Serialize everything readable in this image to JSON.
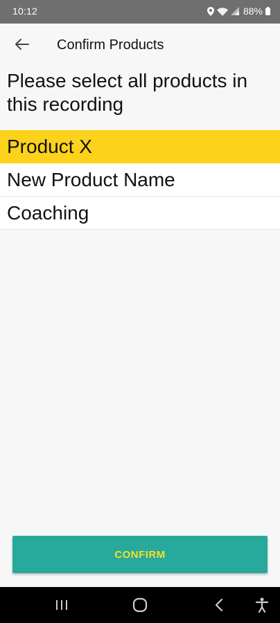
{
  "status_bar": {
    "time": "10:12",
    "battery": "88%",
    "icons": [
      "location-icon",
      "wifi-icon",
      "signal-icon",
      "battery-icon"
    ]
  },
  "app_bar": {
    "title": "Confirm Products",
    "back_icon": "arrow-left-icon"
  },
  "prompt": "Please select all products in this recording",
  "products": [
    {
      "label": "Product X",
      "selected": true
    },
    {
      "label": "New Product Name",
      "selected": false
    },
    {
      "label": "Coaching",
      "selected": false
    }
  ],
  "confirm_button": {
    "label": "CONFIRM"
  },
  "nav_bar": {
    "icons": [
      "recent-apps-icon",
      "home-icon",
      "back-icon",
      "accessibility-icon"
    ]
  },
  "colors": {
    "selected_background": "#fcd21b",
    "button_background": "#27aa9b",
    "button_text": "#f5df2a",
    "status_bar": "#6f6f6f"
  }
}
